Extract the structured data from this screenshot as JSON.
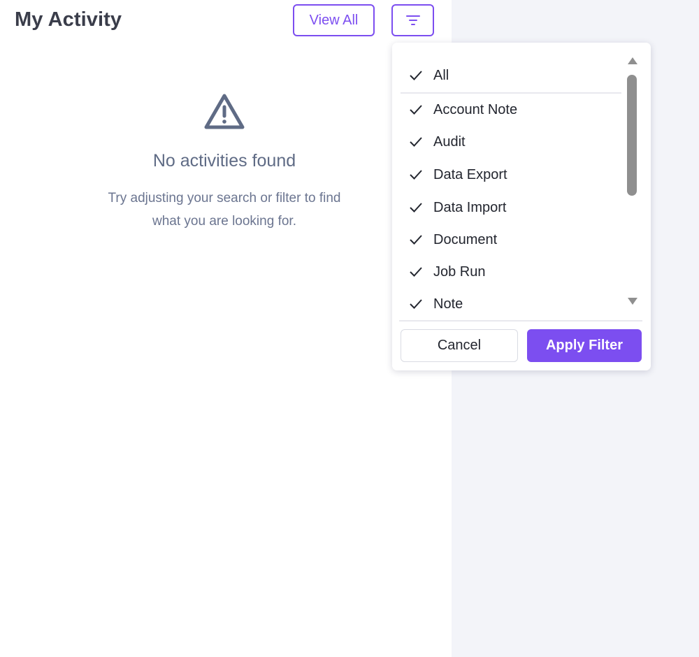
{
  "header": {
    "title": "My Activity",
    "view_all_label": "View All",
    "filter_icon": "filter-icon"
  },
  "empty_state": {
    "icon": "warning-triangle-icon",
    "title": "No activities found",
    "description": "Try adjusting your search or filter to find what you are looking for."
  },
  "filter_dropdown": {
    "options": [
      {
        "label": "All",
        "checked": true
      },
      {
        "label": "Account Note",
        "checked": true
      },
      {
        "label": "Audit",
        "checked": true
      },
      {
        "label": "Data Export",
        "checked": true
      },
      {
        "label": "Data Import",
        "checked": true
      },
      {
        "label": "Document",
        "checked": true
      },
      {
        "label": "Job Run",
        "checked": true
      },
      {
        "label": "Note",
        "checked": true
      }
    ],
    "cancel_label": "Cancel",
    "apply_label": "Apply Filter"
  },
  "colors": {
    "accent": "#7c4ef0",
    "background": "#f3f4f9",
    "muted_text": "#5f6b85"
  }
}
